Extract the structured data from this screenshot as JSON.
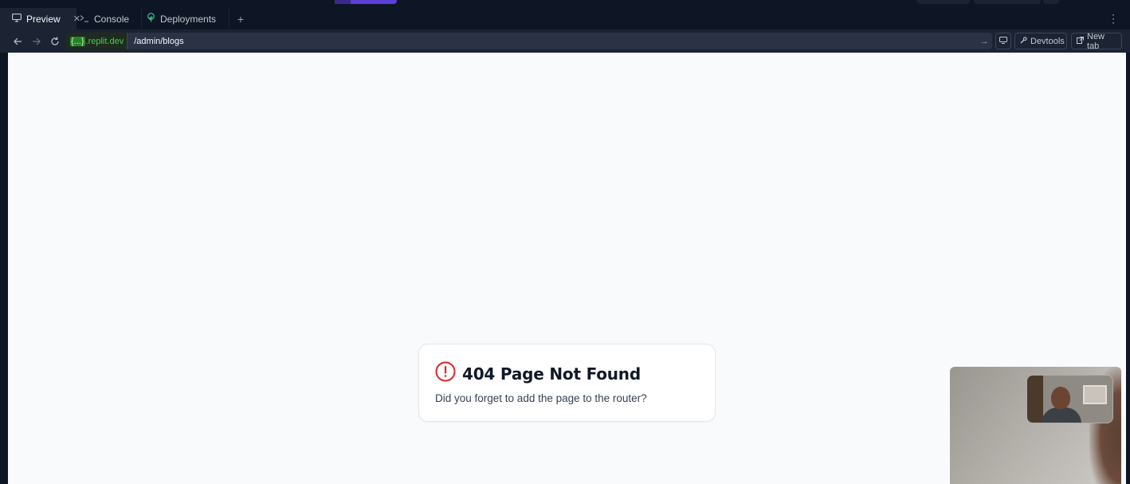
{
  "tabs": [
    {
      "label": "Preview",
      "icon": "monitor-icon",
      "active": true
    },
    {
      "label": "Console",
      "icon": "terminal-icon",
      "active": false
    },
    {
      "label": "Deployments",
      "icon": "deploy-icon",
      "active": false
    }
  ],
  "urlbar": {
    "domain_badge": "{...}",
    "domain_suffix": ".replit.dev",
    "path": "/admin/blogs",
    "devtools_label": "Devtools",
    "newtab_label": "New tab"
  },
  "page": {
    "title": "404 Page Not Found",
    "message": "Did you forget to add the page to the router?"
  },
  "colors": {
    "accent": "#5b3fd6",
    "error": "#dc2626",
    "domain_green": "#43d14d",
    "viewport_bg": "#f8fafc"
  }
}
